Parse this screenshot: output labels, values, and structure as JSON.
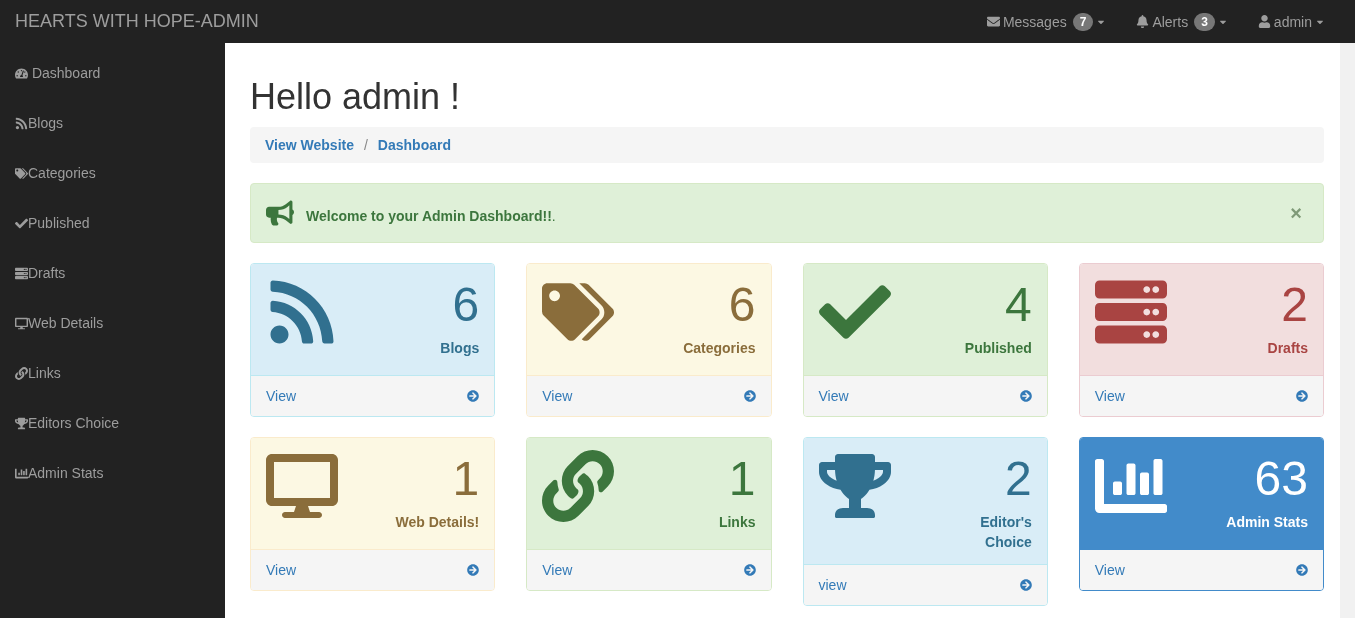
{
  "navbar": {
    "brand": "HEARTS WITH HOPE-ADMIN",
    "menus": [
      {
        "kind": "messages",
        "label": "Messages",
        "count": "7"
      },
      {
        "kind": "alerts",
        "label": "Alerts",
        "count": "3"
      },
      {
        "kind": "user",
        "label": "admin"
      }
    ]
  },
  "sidebar": {
    "items": [
      {
        "label": " Dashboard"
      },
      {
        "label": "Blogs"
      },
      {
        "label": "Categories"
      },
      {
        "label": "Published"
      },
      {
        "label": "Drafts"
      },
      {
        "label": "Web Details"
      },
      {
        "label": "Links"
      },
      {
        "label": "Editors Choice"
      },
      {
        "label": "Admin Stats"
      }
    ]
  },
  "page": {
    "title": "Hello admin !",
    "breadcrumb": [
      "View Website",
      "Dashboard"
    ],
    "breadcrumb_separator": "/",
    "alert": {
      "message": "**Welcome to your Admin Dashboard!!**.",
      "close": "×"
    }
  },
  "cards": [
    {
      "kind": "info",
      "count": "6",
      "label": "Blogs",
      "link": "View"
    },
    {
      "kind": "warning",
      "count": "6",
      "label": "Categories",
      "link": "View"
    },
    {
      "kind": "success",
      "count": "4",
      "label": "Published",
      "link": "View"
    },
    {
      "kind": "danger",
      "count": "2",
      "label": "Drafts",
      "link": "View"
    },
    {
      "kind": "warning",
      "count": "1",
      "label": "Web Details!",
      "link": "View"
    },
    {
      "kind": "success",
      "count": "1",
      "label": "Links",
      "link": "View"
    },
    {
      "kind": "info",
      "count": "2",
      "label": "Editor's Choice",
      "link": "view"
    },
    {
      "kind": "primary",
      "count": "63",
      "label": "Admin Stats",
      "link": "View"
    }
  ]
}
